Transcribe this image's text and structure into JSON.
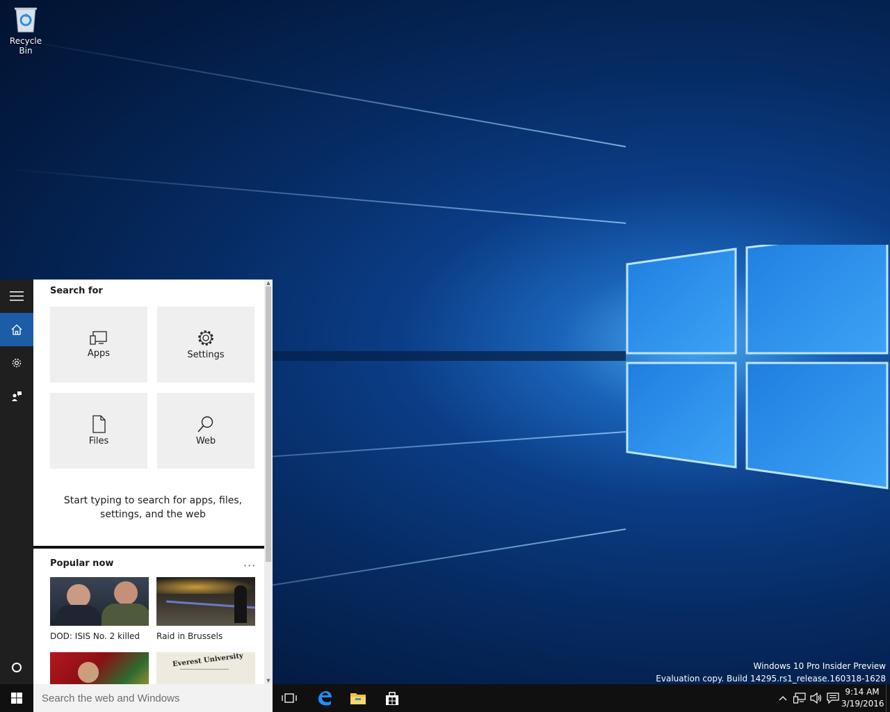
{
  "desktop": {
    "icons": [
      {
        "label": "Recycle Bin",
        "icon": "recycle-bin-icon"
      }
    ],
    "watermark": {
      "line1": "Windows 10 Pro Insider Preview",
      "line2": "Evaluation copy. Build 14295.rs1_release.160318-1628"
    }
  },
  "cortana": {
    "rail": {
      "items": [
        {
          "name": "menu",
          "icon": "hamburger-icon"
        },
        {
          "name": "home",
          "icon": "home-icon",
          "active": true
        },
        {
          "name": "settings",
          "icon": "gear-icon"
        },
        {
          "name": "feedback",
          "icon": "feedback-icon"
        }
      ],
      "bottom_icon": "cortana-circle-icon"
    },
    "search_for": {
      "title": "Search for",
      "tiles": [
        {
          "label": "Apps",
          "icon": "apps-icon"
        },
        {
          "label": "Settings",
          "icon": "gear-icon"
        },
        {
          "label": "Files",
          "icon": "file-icon"
        },
        {
          "label": "Web",
          "icon": "search-icon"
        }
      ],
      "hint": "Start typing to search for apps, files, settings, and the web"
    },
    "popular_now": {
      "title": "Popular now",
      "more": "···",
      "items": [
        {
          "caption": "DOD: ISIS No. 2 killed"
        },
        {
          "caption": "Raid in Brussels"
        },
        {
          "caption": ""
        },
        {
          "caption": ""
        }
      ],
      "image_text": "Everest University"
    }
  },
  "taskbar": {
    "search_placeholder": "Search the web and Windows",
    "pinned": [
      {
        "name": "task-view",
        "icon": "task-view-icon"
      },
      {
        "name": "edge",
        "icon": "edge-icon",
        "color": "#1e90ff"
      },
      {
        "name": "file-explorer",
        "icon": "folder-icon",
        "color": "#f3c237"
      },
      {
        "name": "store",
        "icon": "store-icon"
      }
    ],
    "tray": {
      "icons": [
        "chevron-up-icon",
        "network-icon",
        "volume-icon",
        "action-center-icon"
      ],
      "time": "9:14 AM",
      "date": "3/19/2016"
    }
  }
}
